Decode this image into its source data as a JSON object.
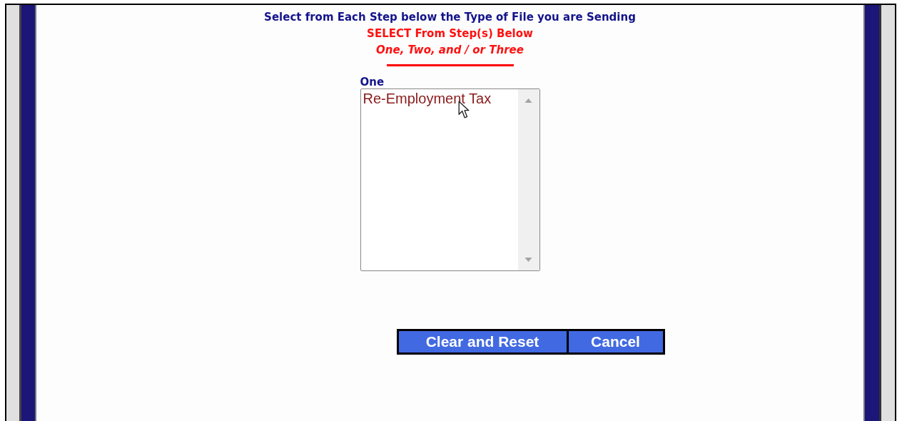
{
  "heading": "Select from Each Step below the Type of File you are Sending",
  "instruction": "SELECT From Step(s) Below",
  "steps_note": "One, Two, and / or Three",
  "step": {
    "label": "One",
    "options": [
      {
        "label": "Re-Employment Tax",
        "selected": false
      }
    ]
  },
  "buttons": [
    "Clear and Reset",
    "Cancel"
  ]
}
